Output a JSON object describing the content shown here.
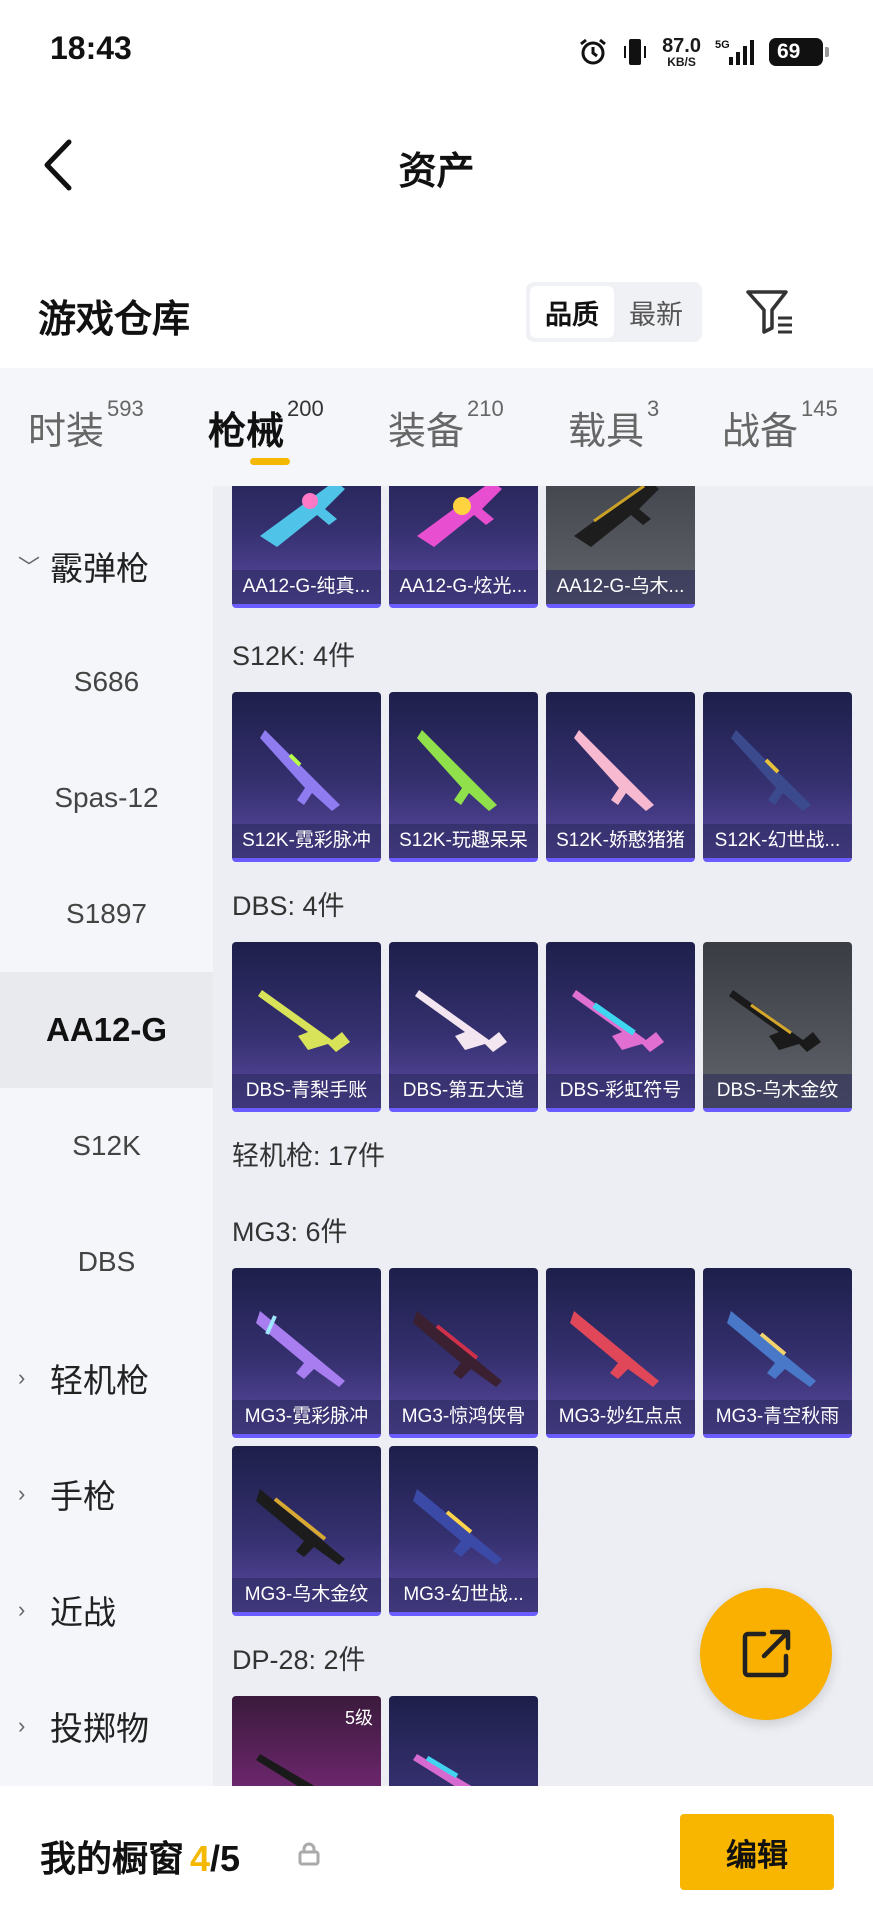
{
  "status_bar": {
    "time": "18:43",
    "net_speed": "87.0",
    "net_unit": "KB/S",
    "signal": "5G",
    "battery": "69"
  },
  "header": {
    "title": "资产"
  },
  "section": {
    "title": "游戏仓库",
    "sort_options": [
      "品质",
      "最新"
    ],
    "active_sort": "品质"
  },
  "tabs": [
    {
      "label": "时装",
      "count": "593"
    },
    {
      "label": "枪械",
      "count": "200"
    },
    {
      "label": "装备",
      "count": "210"
    },
    {
      "label": "载具",
      "count": "3"
    },
    {
      "label": "战备",
      "count": "145"
    }
  ],
  "sidebar": [
    {
      "label": "霰弹枪",
      "type": "group",
      "expanded": true
    },
    {
      "label": "S686",
      "type": "sub"
    },
    {
      "label": "Spas-12",
      "type": "sub"
    },
    {
      "label": "S1897",
      "type": "sub"
    },
    {
      "label": "AA12-G",
      "type": "sub",
      "active": true
    },
    {
      "label": "S12K",
      "type": "sub"
    },
    {
      "label": "DBS",
      "type": "sub"
    },
    {
      "label": "轻机枪",
      "type": "group"
    },
    {
      "label": "手枪",
      "type": "group"
    },
    {
      "label": "近战",
      "type": "group"
    },
    {
      "label": "投掷物",
      "type": "group"
    }
  ],
  "groups": {
    "aa12": {
      "items": [
        "AA12-G-纯真...",
        "AA12-G-炫光...",
        "AA12-G-乌木..."
      ]
    },
    "s12k": {
      "label": "S12K: 4件",
      "items": [
        "S12K-霓彩脉冲",
        "S12K-玩趣呆呆",
        "S12K-娇憨猪猪",
        "S12K-幻世战..."
      ]
    },
    "dbs": {
      "label": "DBS: 4件",
      "items": [
        "DBS-青梨手账",
        "DBS-第五大道",
        "DBS-彩虹符号",
        "DBS-乌木金纹"
      ]
    },
    "lmg": {
      "label": "轻机枪: 17件"
    },
    "mg3": {
      "label": "MG3: 6件",
      "items": [
        "MG3-霓彩脉冲",
        "MG3-惊鸿侠骨",
        "MG3-妙红点点",
        "MG3-青空秋雨",
        "MG3-乌木金纹",
        "MG3-幻世战..."
      ]
    },
    "dp28": {
      "label": "DP-28: 2件",
      "level": "5级"
    }
  },
  "bottom": {
    "label": "我的橱窗",
    "current": "4",
    "total": "/5",
    "edit": "编辑"
  },
  "colors": {
    "accent": "#f5b800",
    "card_purple": "#35306f",
    "card_gray": "#52545c"
  }
}
